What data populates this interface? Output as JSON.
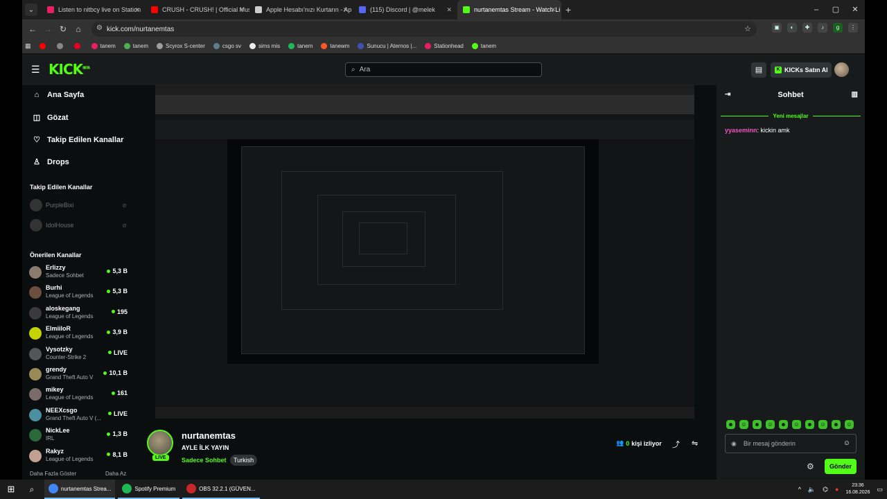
{
  "browser": {
    "tabs": [
      {
        "label": "Listen to nitbcy live on Station",
        "color": "#e91e63"
      },
      {
        "label": "CRUSH - CRUSH! | Official Mus",
        "color": "#ff0000"
      },
      {
        "label": "Apple Hesabı'nızı Kurtarın - Ap",
        "color": "#cccccc"
      },
      {
        "label": "(115) Discord | @melek",
        "color": "#5865f2"
      },
      {
        "label": "nurtanemtas Stream - Watch Li",
        "color": "#53fc18"
      }
    ],
    "url": "kick.com/nurtanemtas",
    "bookmarks": [
      {
        "label": "",
        "color": "#ff0000"
      },
      {
        "label": "",
        "color": "#888888"
      },
      {
        "label": "",
        "color": "#e60023"
      },
      {
        "label": "tanem",
        "color": "#e91e63"
      },
      {
        "label": "tanem",
        "color": "#4caf50"
      },
      {
        "label": "Scyrox S-center",
        "color": "#9e9e9e"
      },
      {
        "label": "csgo sv",
        "color": "#607d8b"
      },
      {
        "label": "sims mis",
        "color": "#eeeeee"
      },
      {
        "label": "tanem",
        "color": "#1db954"
      },
      {
        "label": "tanewm",
        "color": "#ff5722"
      },
      {
        "label": "Sunucu | Aternos |...",
        "color": "#3f51b5"
      },
      {
        "label": "Stationhead",
        "color": "#e91e63"
      },
      {
        "label": "tanem",
        "color": "#53fc18"
      }
    ]
  },
  "header": {
    "logo": "KICK",
    "logo_sup": "BETA",
    "search_placeholder": "Ara",
    "buy_kicks": "KICKs Satın Al"
  },
  "sidebar": {
    "nav": [
      "Ana Sayfa",
      "Gözat",
      "Takip Edilen Kanallar",
      "Drops"
    ],
    "followed_title": "Takip Edilen Kanallar",
    "followed": [
      "PurpleBixi",
      "IdolHouse"
    ],
    "recommended_title": "Önerilen Kanallar",
    "recommended": [
      {
        "name": "Erlizzy",
        "category": "Sadece Sohbet",
        "viewers": "5,3 B",
        "color": "#8a7b6e"
      },
      {
        "name": "Burhi",
        "category": "League of Legends",
        "viewers": "5,3 B",
        "color": "#6b4e3d"
      },
      {
        "name": "aloskegang",
        "category": "League of Legends",
        "viewers": "195",
        "color": "#3a3a3a"
      },
      {
        "name": "ElmiiloR",
        "category": "League of Legends",
        "viewers": "3,9 B",
        "color": "#c5d300"
      },
      {
        "name": "Vysotzky",
        "category": "Counter-Strike 2",
        "viewers": "LIVE",
        "color": "#555555"
      },
      {
        "name": "grendy",
        "category": "Grand Theft Auto V",
        "viewers": "10,1 B",
        "color": "#9a8a5a"
      },
      {
        "name": "mikey",
        "category": "League of Legends",
        "viewers": "161",
        "color": "#7a6a6a"
      },
      {
        "name": "NEEXcsgo",
        "category": "Grand Theft Auto V (...",
        "viewers": "LIVE",
        "color": "#4a90a0"
      },
      {
        "name": "NickLee",
        "category": "IRL",
        "viewers": "1,3 B",
        "color": "#2a6a3a"
      },
      {
        "name": "Rakyz",
        "category": "League of Legends",
        "viewers": "8,1 B",
        "color": "#c0a090"
      }
    ],
    "show_more": "Daha Fazla Göster",
    "show_less": "Daha Az"
  },
  "channel": {
    "name": "nurtanemtas",
    "title": "AYLE İLK YAYIN",
    "category": "Sadece Sohbet",
    "tag": "Turkish",
    "live": "LIVE",
    "viewers_count": "0",
    "viewers_label": "kişi izliyor"
  },
  "chat": {
    "title": "Sohbet",
    "new_messages": "Yeni mesajlar",
    "messages": [
      {
        "user": "yyaseminn",
        "text": "kickin amk"
      }
    ],
    "input_placeholder": "Bir mesaj gönderin",
    "send": "Gönder"
  },
  "taskbar": {
    "apps": [
      {
        "label": "nurtanemtas Strea...",
        "color": "#4285f4"
      },
      {
        "label": "Spotify Premium",
        "color": "#1db954"
      },
      {
        "label": "OBS 32.2.1 (GÜVEN...",
        "color": "#c62828"
      }
    ],
    "time": "23:36",
    "date": "16.08.2026"
  }
}
